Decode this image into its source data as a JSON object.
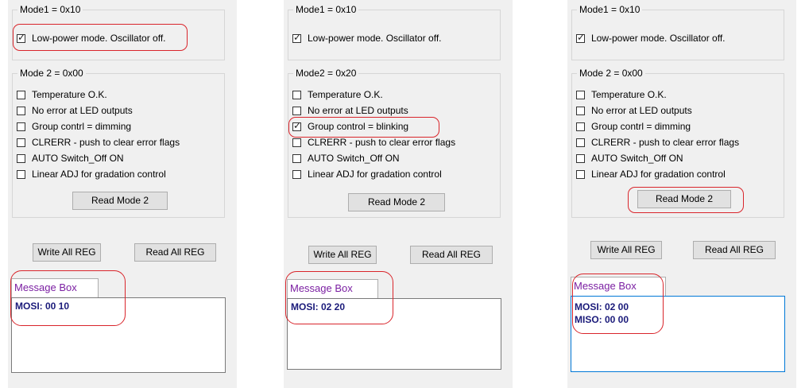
{
  "panels": [
    {
      "mode1": {
        "title": "Mode1 = 0x10",
        "checkbox": {
          "label": "Low-power mode. Oscillator off.",
          "checked": true
        }
      },
      "mode2": {
        "title": "Mode 2 = 0x00",
        "items": [
          {
            "label": "Temperature O.K.",
            "checked": false
          },
          {
            "label": "No error at LED outputs",
            "checked": false
          },
          {
            "label": "Group contrl = dimming",
            "checked": false
          },
          {
            "label": "CLRERR - push to clear error flags",
            "checked": false
          },
          {
            "label": "AUTO Switch_Off ON",
            "checked": false
          },
          {
            "label": "Linear ADJ for gradation control",
            "checked": false
          }
        ],
        "read_button": "Read Mode 2"
      },
      "write_all": "Write All REG",
      "read_all": "Read All REG",
      "message_tab": "Message Box",
      "messages": [
        "MOSI: 00 10"
      ]
    },
    {
      "mode1": {
        "title": "Mode1 = 0x10",
        "checkbox": {
          "label": "Low-power mode. Oscillator off.",
          "checked": true
        }
      },
      "mode2": {
        "title": "Mode2 = 0x20",
        "items": [
          {
            "label": "Temperature O.K.",
            "checked": false
          },
          {
            "label": "No error at LED outputs",
            "checked": false
          },
          {
            "label": "Group control = blinking",
            "checked": true
          },
          {
            "label": "CLRERR - push to clear error flags",
            "checked": false
          },
          {
            "label": "AUTO Switch_Off ON",
            "checked": false
          },
          {
            "label": "Linear ADJ for gradation control",
            "checked": false
          }
        ],
        "read_button": "Read Mode 2"
      },
      "write_all": "Write All REG",
      "read_all": "Read All REG",
      "message_tab": "Message Box",
      "messages": [
        "MOSI: 02 20"
      ]
    },
    {
      "mode1": {
        "title": "Mode1 = 0x10",
        "checkbox": {
          "label": "Low-power mode. Oscillator off.",
          "checked": true
        }
      },
      "mode2": {
        "title": "Mode 2 = 0x00",
        "items": [
          {
            "label": "Temperature O.K.",
            "checked": false
          },
          {
            "label": "No error at LED outputs",
            "checked": false
          },
          {
            "label": "Group contrl = dimming",
            "checked": false
          },
          {
            "label": "CLRERR - push to clear error flags",
            "checked": false
          },
          {
            "label": "AUTO Switch_Off ON",
            "checked": false
          },
          {
            "label": "Linear ADJ for gradation control",
            "checked": false
          }
        ],
        "read_button": "Read Mode 2"
      },
      "write_all": "Write All REG",
      "read_all": "Read All REG",
      "message_tab": "Message Box",
      "messages": [
        "MOSI: 02 00",
        "MISO: 00 00"
      ]
    }
  ],
  "colors": {
    "highlight": "#d9252b",
    "message_tab_text": "#7b1fa2",
    "message_text": "#1a1a7a",
    "focus_border": "#0078d7"
  }
}
